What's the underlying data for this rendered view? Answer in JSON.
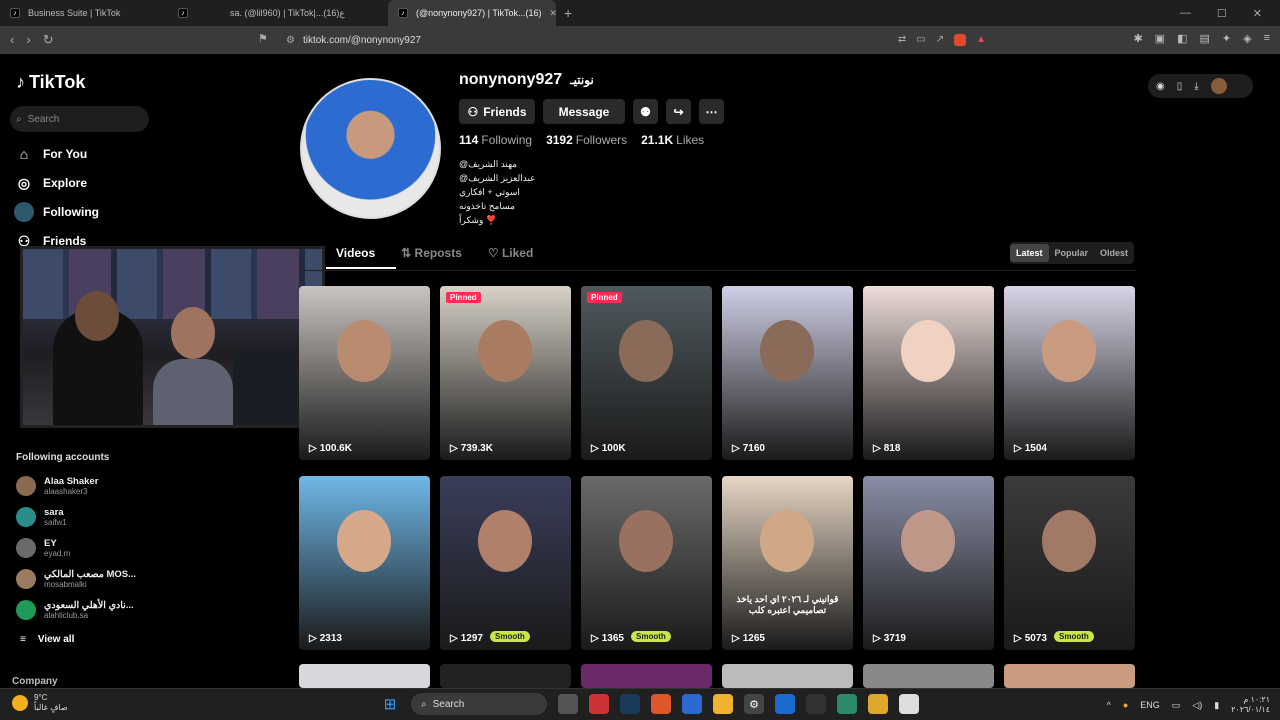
{
  "browser": {
    "tabs": [
      {
        "title": "Business Suite | TikTok",
        "active": false
      },
      {
        "title": "",
        "active": false
      },
      {
        "title": "sa. (@lil960) | TikTok|...ع(16)",
        "active": false
      },
      {
        "title": "(@nonynony927) | TikTok...(16)",
        "active": true
      }
    ],
    "url": "tiktok.com/@nonynony927"
  },
  "sidebar": {
    "logo": "TikTok",
    "search_placeholder": "Search",
    "nav": [
      {
        "label": "For You",
        "icon": "home-icon"
      },
      {
        "label": "Explore",
        "icon": "compass-icon"
      },
      {
        "label": "Following",
        "icon": "following-icon"
      },
      {
        "label": "Friends",
        "icon": "friends-icon"
      }
    ],
    "following_title": "Following accounts",
    "accounts": [
      {
        "name": "Alaa Shaker",
        "handle": "alaashaker3",
        "color": "#8a6a50"
      },
      {
        "name": "sara",
        "handle": "saifw1",
        "color": "#2c8c8c"
      },
      {
        "name": "EY",
        "handle": "eyad.m",
        "color": "#6a6a6a"
      },
      {
        "name": "مصعب المالكي MOS...",
        "handle": "mosabmalki",
        "color": "#9a7a60"
      },
      {
        "name": "نادي الأهلي السعودي...",
        "handle": "alahliclub.sa",
        "color": "#1e9a5a"
      }
    ],
    "view_all": "View all",
    "company": "Company"
  },
  "profile": {
    "username": "nonynony927",
    "nickname": "نونتيـ",
    "buttons": {
      "friends": "Friends",
      "message": "Message"
    },
    "stats": [
      {
        "value": "114",
        "label": "Following"
      },
      {
        "value": "3192",
        "label": "Followers"
      },
      {
        "value": "21.1K",
        "label": "Likes"
      }
    ],
    "bio": [
      "@مهند الشريف",
      "@عبدالعزيز الشريف",
      "اسوتي + افكاري",
      "مسامح تاخذونه",
      "وشكراً ❣️"
    ]
  },
  "content_tabs": [
    "Videos",
    "Reposts",
    "Liked"
  ],
  "sort": [
    "Latest",
    "Popular",
    "Oldest"
  ],
  "videos": [
    {
      "views": "100.6K",
      "pinned": false,
      "bg": "#c9c4bf",
      "face": "#b88a6e"
    },
    {
      "views": "739.3K",
      "pinned": true,
      "pin_label": "Pinned",
      "bg": "#d8d2c8",
      "face": "#a97c62"
    },
    {
      "views": "100K",
      "pinned": true,
      "pin_label": "Pinned",
      "bg": "#4f5a5e",
      "face": "#8a6a58"
    },
    {
      "views": "7160",
      "pinned": false,
      "bg": "#cfcfe6",
      "face": "#8a6a58"
    },
    {
      "views": "818",
      "pinned": false,
      "bg": "#eddcd8",
      "face": "#f0d2c2"
    },
    {
      "views": "1504",
      "pinned": false,
      "bg": "#d9d4e6",
      "face": "#c99c80"
    },
    {
      "views": "2313",
      "pinned": false,
      "bg": "#6fb8e8",
      "face": "#d6a88a"
    },
    {
      "views": "1297",
      "pinned": false,
      "badge": "Smooth",
      "bg": "#3a3e5a",
      "face": "#b0806a"
    },
    {
      "views": "1365",
      "pinned": false,
      "badge": "Smooth",
      "bg": "#6a6a6a",
      "face": "#9a7060"
    },
    {
      "views": "1265",
      "pinned": false,
      "caption": "قوانيني لـ ٢٠٢٦ اي احد ياخذ تصاميمي اعتبره كلب",
      "bg": "#e6d6c4",
      "face": "#d0a888"
    },
    {
      "views": "3719",
      "pinned": false,
      "bg": "#8a8ea6",
      "face": "#c0988a"
    },
    {
      "views": "5073",
      "pinned": false,
      "badge": "Smooth",
      "bg": "#3c3a3a",
      "face": "#a07a66"
    }
  ],
  "taskbar": {
    "weather_temp": "9°C",
    "weather_text": "صافٍ غالباً",
    "search": "Search",
    "lang": "ENG",
    "time": "١٠:٢١ م",
    "date": "٢٠٢٦/٠١/١٤"
  }
}
